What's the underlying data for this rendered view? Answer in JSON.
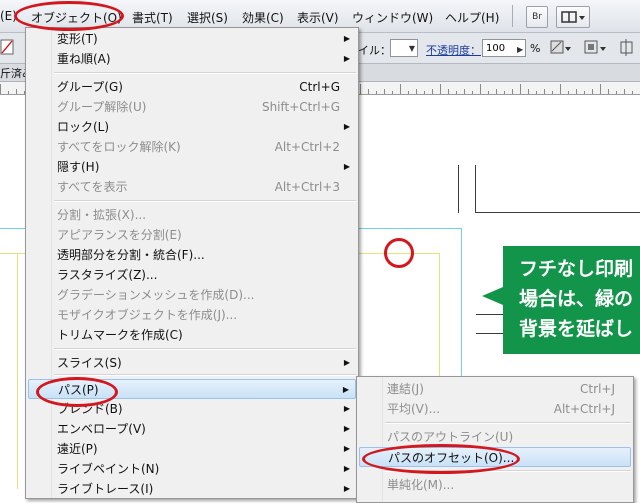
{
  "menubar": {
    "items": [
      {
        "label": "(E)"
      },
      {
        "label": "オブジェクト(O)"
      },
      {
        "label": "書式(T)"
      },
      {
        "label": "選択(S)"
      },
      {
        "label": "効果(C)"
      },
      {
        "label": "表示(V)"
      },
      {
        "label": "ウィンドウ(W)"
      },
      {
        "label": "ヘルプ(H)"
      }
    ],
    "bridge_label": "Br",
    "arrange_icon": "workspace-arrange-icon"
  },
  "controlbar": {
    "style_label": "イル：",
    "opacity_label": "不透明度：",
    "opacity_value": "100",
    "percent": "%"
  },
  "docbar": {
    "tab_fragment": "斤済み"
  },
  "object_menu": {
    "items": [
      {
        "label": "変形(T)",
        "shortcut": "",
        "submenu": true,
        "enabled": true
      },
      {
        "label": "重ね順(A)",
        "shortcut": "",
        "submenu": true,
        "enabled": true
      },
      {
        "label": "グループ(G)",
        "shortcut": "Ctrl+G",
        "submenu": false,
        "enabled": true
      },
      {
        "label": "グループ解除(U)",
        "shortcut": "Shift+Ctrl+G",
        "submenu": false,
        "enabled": false
      },
      {
        "label": "ロック(L)",
        "shortcut": "",
        "submenu": true,
        "enabled": true
      },
      {
        "label": "すべてをロック解除(K)",
        "shortcut": "Alt+Ctrl+2",
        "submenu": false,
        "enabled": false
      },
      {
        "label": "隠す(H)",
        "shortcut": "",
        "submenu": true,
        "enabled": true
      },
      {
        "label": "すべてを表示",
        "shortcut": "Alt+Ctrl+3",
        "submenu": false,
        "enabled": false
      },
      {
        "label": "分割・拡張(X)...",
        "shortcut": "",
        "submenu": false,
        "enabled": false
      },
      {
        "label": "アピアランスを分割(E)",
        "shortcut": "",
        "submenu": false,
        "enabled": false
      },
      {
        "label": "透明部分を分割・統合(F)...",
        "shortcut": "",
        "submenu": false,
        "enabled": true
      },
      {
        "label": "ラスタライズ(Z)...",
        "shortcut": "",
        "submenu": false,
        "enabled": true
      },
      {
        "label": "グラデーションメッシュを作成(D)...",
        "shortcut": "",
        "submenu": false,
        "enabled": false
      },
      {
        "label": "モザイクオブジェクトを作成(J)...",
        "shortcut": "",
        "submenu": false,
        "enabled": false
      },
      {
        "label": "トリムマークを作成(C)",
        "shortcut": "",
        "submenu": false,
        "enabled": true
      },
      {
        "label": "スライス(S)",
        "shortcut": "",
        "submenu": true,
        "enabled": true
      },
      {
        "label": "パス(P)",
        "shortcut": "",
        "submenu": true,
        "enabled": true,
        "highlighted": true
      },
      {
        "label": "ブレンド(B)",
        "shortcut": "",
        "submenu": true,
        "enabled": true
      },
      {
        "label": "エンベロープ(V)",
        "shortcut": "",
        "submenu": true,
        "enabled": true
      },
      {
        "label": "遠近(P)",
        "shortcut": "",
        "submenu": true,
        "enabled": true
      },
      {
        "label": "ライブペイント(N)",
        "shortcut": "",
        "submenu": true,
        "enabled": true
      },
      {
        "label": "ライブトレース(I)",
        "shortcut": "",
        "submenu": true,
        "enabled": true
      }
    ]
  },
  "path_submenu": {
    "items": [
      {
        "label": "連結(J)",
        "shortcut": "Ctrl+J",
        "enabled": false
      },
      {
        "label": "平均(V)...",
        "shortcut": "Alt+Ctrl+J",
        "enabled": false
      },
      {
        "label": "パスのアウトライン(U)",
        "shortcut": "",
        "enabled": false
      },
      {
        "label": "パスのオフセット(O)...",
        "shortcut": "",
        "enabled": true,
        "highlighted": true
      },
      {
        "label": "単純化(M)...",
        "shortcut": "",
        "enabled": false
      }
    ]
  },
  "callout": {
    "line1": "フチなし印刷",
    "line2": "場合は、緑の",
    "line3": "背景を延ばし"
  },
  "colors": {
    "annotation_red": "#d4161d",
    "callout_green": "#12944a",
    "menu_bg": "#f0f0f0",
    "highlight": "#c9e1f7"
  }
}
